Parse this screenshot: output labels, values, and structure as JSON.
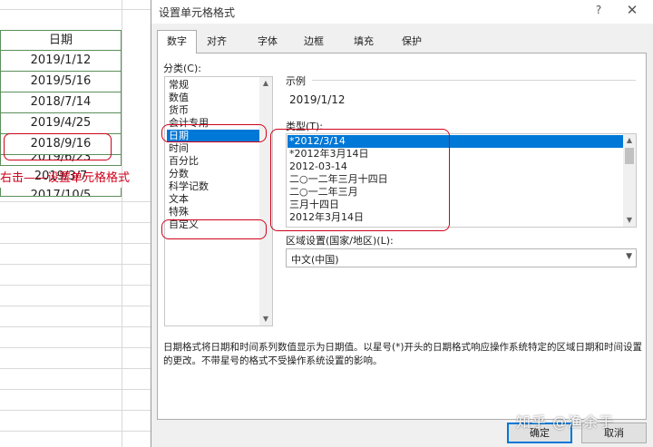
{
  "sheet": {
    "header": "日期",
    "dates": [
      "2019/1/12",
      "2019/5/16",
      "2018/7/14",
      "2019/4/25",
      "2018/9/16",
      "2019/6/23",
      "2019/3/7",
      "2017/10/5"
    ],
    "note": "右击——设置单元格格式"
  },
  "dialog": {
    "title": "设置单元格格式",
    "help": "?",
    "close": "✕",
    "tabs": [
      "数字",
      "对齐",
      "字体",
      "边框",
      "填充",
      "保护"
    ],
    "category_label": "分类(C):",
    "categories": [
      "常规",
      "数值",
      "货币",
      "会计专用",
      "日期",
      "时间",
      "百分比",
      "分数",
      "科学记数",
      "文本",
      "特殊",
      "自定义"
    ],
    "selected_category": "日期",
    "sample_label": "示例",
    "sample_value": "2019/1/12",
    "type_label": "类型(T):",
    "types": [
      "*2012/3/14",
      "*2012年3月14日",
      "2012-03-14",
      "二○一二年三月十四日",
      "二○一二年三月",
      "三月十四日",
      "2012年3月14日"
    ],
    "locale_label": "区域设置(国家/地区)(L):",
    "locale_value": "中文(中国)",
    "description": "日期格式将日期和时间系列数值显示为日期值。以星号(*)开头的日期格式响应操作系统特定的区域日期和时间设置的更改。不带星号的格式不受操作系统设置的影响。",
    "ok": "确定",
    "cancel": "取消"
  },
  "watermark": "知乎 @渔余于",
  "colors": {
    "annotation": "#d0021b",
    "selection": "#0078d7",
    "cell_border": "#5b8f5b"
  }
}
